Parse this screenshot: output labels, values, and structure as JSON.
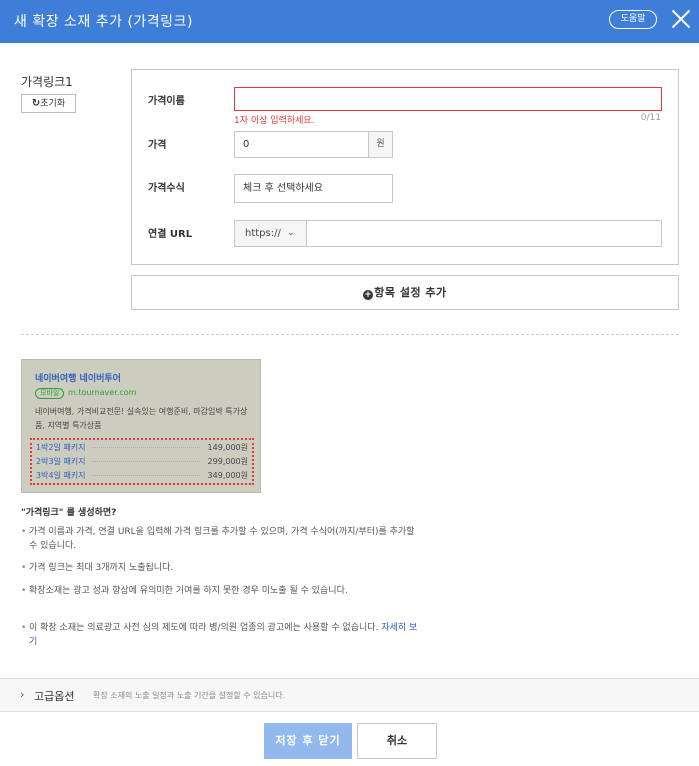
{
  "header": {
    "title": "새 확장 소재 추가 (가격링크)",
    "help_label": "도움말"
  },
  "item": {
    "name": "가격링크1",
    "reset_label": "초기화"
  },
  "form": {
    "name_label": "가격이름",
    "name_value": "",
    "name_error": "1자 이상 입력하세요.",
    "name_counter": "0/11",
    "price_label": "가격",
    "price_value": "0",
    "price_unit": "원",
    "formula_label": "가격수식",
    "formula_placeholder": "체크 후 선택하세요",
    "url_label": "연결 URL",
    "url_protocol": "https://",
    "url_value": ""
  },
  "add_item_label": "항목 설정 추가",
  "preview": {
    "title": "네이버여행 네이버투어",
    "badge": "모바일",
    "url": "m.tournaver.com",
    "description": "네이버여행, 가격비교전문! 실속있는 여행준비, 마감임박 특가상품, 지역별 특가상품",
    "links": [
      {
        "name": "1박2일 패키지",
        "price": "149,000원"
      },
      {
        "name": "2박3일 패키지",
        "price": "299,000원"
      },
      {
        "name": "3박4일 패키지",
        "price": "349,000원"
      }
    ]
  },
  "info": {
    "title": "\"가격링크\" 를 생성하면?",
    "bullets": [
      "가격 이름과 가격, 연결 URL을 입력해 가격 링크를 추가할 수 있으며, 가격 수식어(까지/부터)를 추가할 수 있습니다.",
      "가격 링크는 최대 3개까지 노출됩니다.",
      "확장소재는 광고 성과 향상에 유의미한 기여를 하지 못한 경우 미노출 될 수 있습니다.",
      "이 확장 소재는 의료광고 사전 심의 제도에 따라 병/의원 업종의 광고에는 사용할 수 없습니다."
    ],
    "more_link": "자세히 보기"
  },
  "advanced": {
    "title": "고급옵션",
    "description": "확장 소재의 노출 일정과 노출 기간을 설정할 수 있습니다."
  },
  "footer": {
    "save_label": "저장 후 닫기",
    "cancel_label": "취소"
  }
}
